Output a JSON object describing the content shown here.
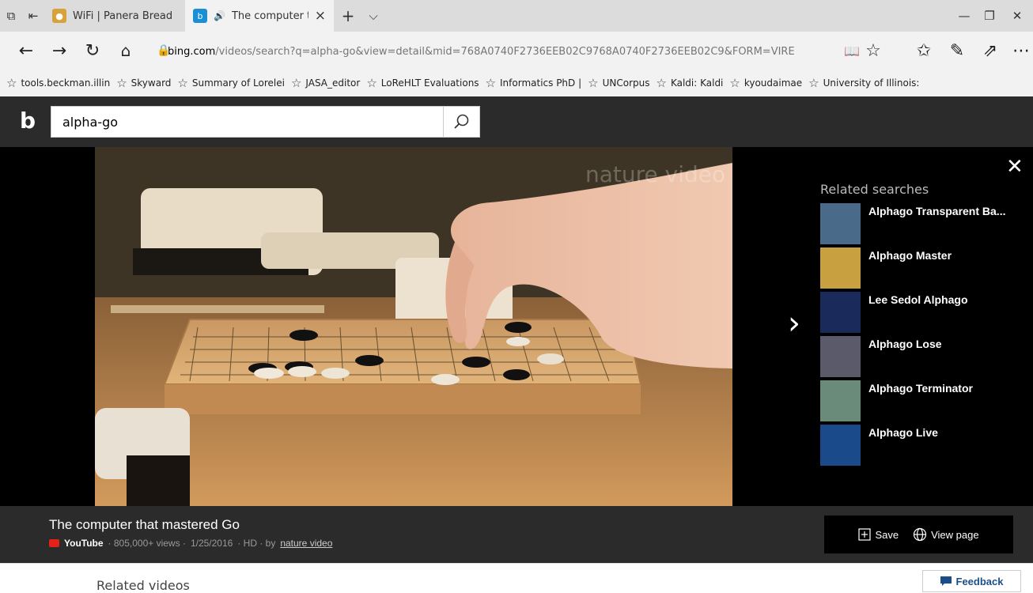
{
  "tabs": [
    {
      "title": "WiFi | Panera Bread",
      "favicon": "panera-icon"
    },
    {
      "title": "The computer that",
      "favicon": "bing-icon",
      "active": true,
      "audio": "🔊"
    }
  ],
  "tab_controls": {
    "new_tab": "+",
    "tab_list": "⌵",
    "close_tab": "×"
  },
  "window_controls": {
    "minimize": "—",
    "restore": "❐",
    "close": "✕"
  },
  "address": {
    "domain": "bing.com",
    "path": "/videos/search?q=alpha-go&view=detail&mid=768A0740F2736EEB02C9768A0740F2736EEB02C9&FORM=VIRE"
  },
  "nav_glyphs": {
    "back": "←",
    "forward": "→",
    "refresh": "↻",
    "home": "⌂",
    "lock": "🔒",
    "read": "📖",
    "star": "☆",
    "favorites": "✩",
    "pen": "✎",
    "share": "⇗",
    "more": "⋯"
  },
  "bookmarks": [
    "tools.beckman.illin",
    "Skyward",
    "Summary of Lorelei",
    "JASA_editor",
    "LoReHLT Evaluations",
    "Informatics PhD |",
    "UNCorpus",
    "Kaldi: Kaldi",
    "kyoudaimae",
    "University of Illinois:"
  ],
  "search": {
    "query": "alpha-go"
  },
  "player": {
    "watermark": "nature video",
    "close": "✕",
    "next": "›"
  },
  "related_searches": {
    "heading": "Related searches",
    "items": [
      {
        "label": "Alphago Transparent Ba...",
        "color": "#4a6a8a"
      },
      {
        "label": "Alphago Master",
        "color": "#c8a040"
      },
      {
        "label": "Lee Sedol Alphago",
        "color": "#1a2a5a"
      },
      {
        "label": "Alphago Lose",
        "color": "#5a5a6a"
      },
      {
        "label": "Alphago Terminator",
        "color": "#6a8a7a"
      },
      {
        "label": "Alphago Live",
        "color": "#1a4a8a"
      }
    ]
  },
  "video": {
    "title": "The computer that mastered Go",
    "source": "YouTube",
    "views": "· 805,000+ views ·",
    "date": "1/25/2016",
    "quality": "· HD · by",
    "author": "nature video"
  },
  "actions": {
    "save": "Save",
    "view_page": "View page"
  },
  "below": {
    "related_videos": "Related videos",
    "feedback": "Feedback"
  }
}
